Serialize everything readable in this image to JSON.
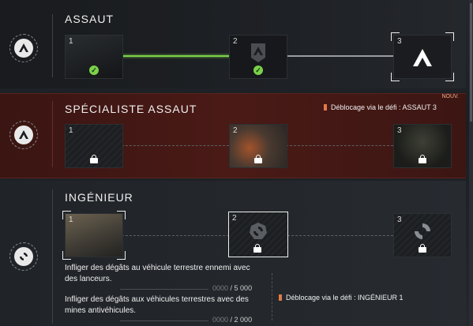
{
  "sections": [
    {
      "title": "ASSAUT",
      "cards": [
        {
          "num": "1"
        },
        {
          "num": "2"
        },
        {
          "num": "3"
        }
      ]
    },
    {
      "title": "SPÉCIALISTE ASSAUT",
      "badge": "NOUV.",
      "unlock": "Déblocage via le défi : ASSAUT 3",
      "cards": [
        {
          "num": "1"
        },
        {
          "num": "2"
        },
        {
          "num": "3"
        }
      ]
    },
    {
      "title": "INGÉNIEUR",
      "unlock": "Déblocage via le défi : INGÉNIEUR 1",
      "cards": [
        {
          "num": "1"
        },
        {
          "num": "2"
        },
        {
          "num": "3"
        }
      ],
      "tasks": [
        {
          "text": "Infliger des dégâts au véhicule terrestre ennemi avec des lanceurs.",
          "zeros": "0000",
          "value": "/ 5 000"
        },
        {
          "text": "Infliger des dégâts aux véhicules terrestres avec des mines antivéhicules.",
          "zeros": "0000",
          "value": "/ 2 000"
        }
      ]
    }
  ],
  "colors": {
    "progress_green": "#7cd14a",
    "specialist_bg": "#4a1a16",
    "unlock_icon": "#e07a4a"
  }
}
